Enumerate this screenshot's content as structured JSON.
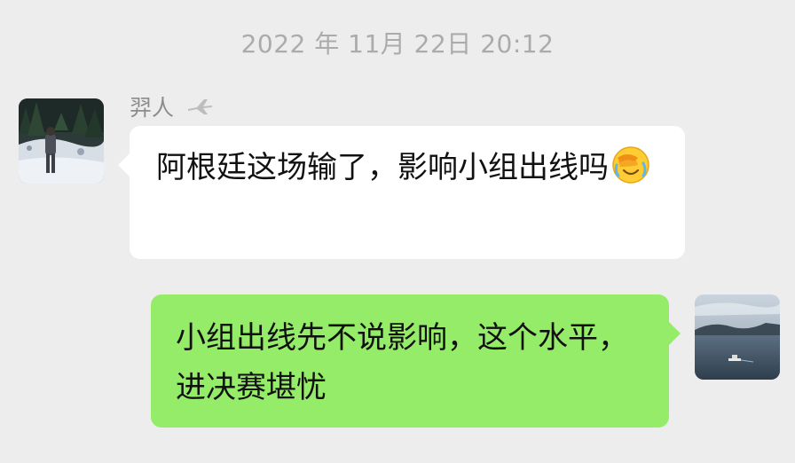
{
  "timestamp": "2022 年 11月 22日 20:12",
  "messages": [
    {
      "side": "left",
      "sender": "羿人",
      "text": "阿根廷这场输了，影响小组出线吗",
      "emoji": "face-with-hand-over-eyes-tears-emoji"
    },
    {
      "side": "right",
      "text": "小组出线先不说影响，这个水平，进决赛堪忧"
    }
  ],
  "icons": {
    "sender_badge": "airplane-icon"
  },
  "colors": {
    "background": "#ededed",
    "incoming_bubble": "#ffffff",
    "outgoing_bubble": "#95ec69",
    "timestamp_text": "#ababab",
    "sender_text": "#8c8c8c"
  }
}
